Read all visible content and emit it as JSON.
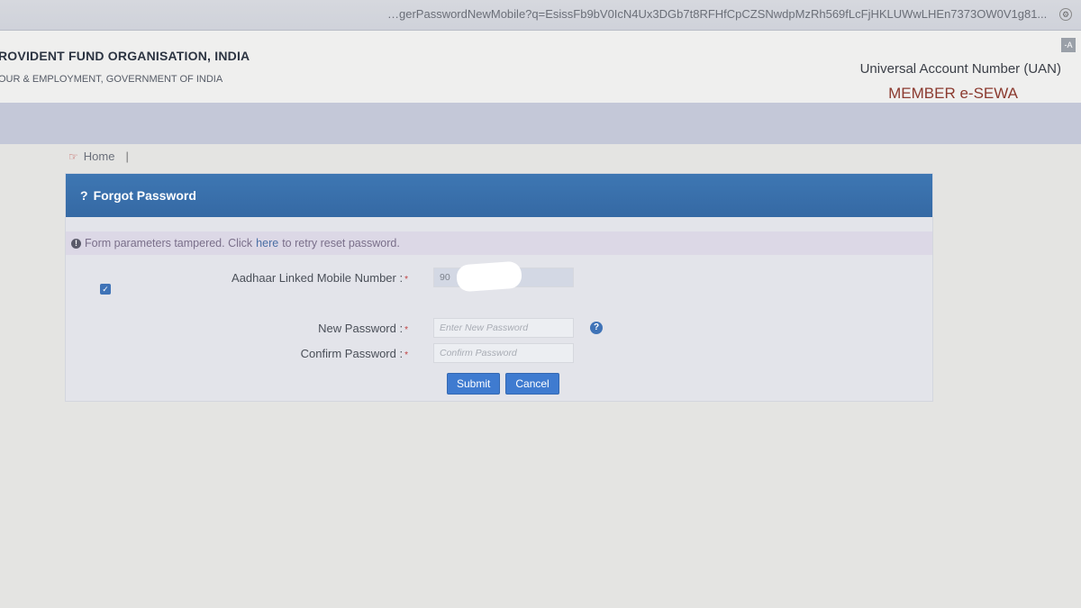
{
  "browser": {
    "url": "…gerPasswordNewMobile?q=EsissFb9bV0IcN4Ux3DGb7t8RFHfCpCZSNwdpMzRh569fLcFjHKLUWwLHEn7373OW0V1g81..."
  },
  "header": {
    "org_name": "ROVIDENT FUND ORGANISATION, INDIA",
    "ministry": "OUR & EMPLOYMENT, GOVERNMENT OF INDIA",
    "uan_title": "Universal Account Number (UAN)",
    "portal_name": "MEMBER e-SEWA",
    "font_toggle": "-A"
  },
  "breadcrumb": {
    "home_label": "Home",
    "separator": "|"
  },
  "panel": {
    "title": "Forgot Password",
    "title_icon": "?"
  },
  "alert": {
    "icon": "!",
    "text_before": "Form parameters tampered. Click",
    "link_text": "here",
    "text_after": "to retry reset password."
  },
  "form": {
    "mobile_label": "Aadhaar Linked Mobile Number :",
    "mobile_value": "90",
    "new_password_label": "New Password :",
    "new_password_placeholder": "Enter New Password",
    "confirm_password_label": "Confirm Password :",
    "confirm_password_placeholder": "Confirm Password",
    "required_mark": "*",
    "help_icon": "?",
    "checkbox_mark": "✓",
    "checkbox_checked": true
  },
  "buttons": {
    "submit": "Submit",
    "cancel": "Cancel"
  },
  "colors": {
    "panel_header": "#3569a4",
    "button": "#3f7bd0",
    "portal_name": "#8b3a2f"
  }
}
